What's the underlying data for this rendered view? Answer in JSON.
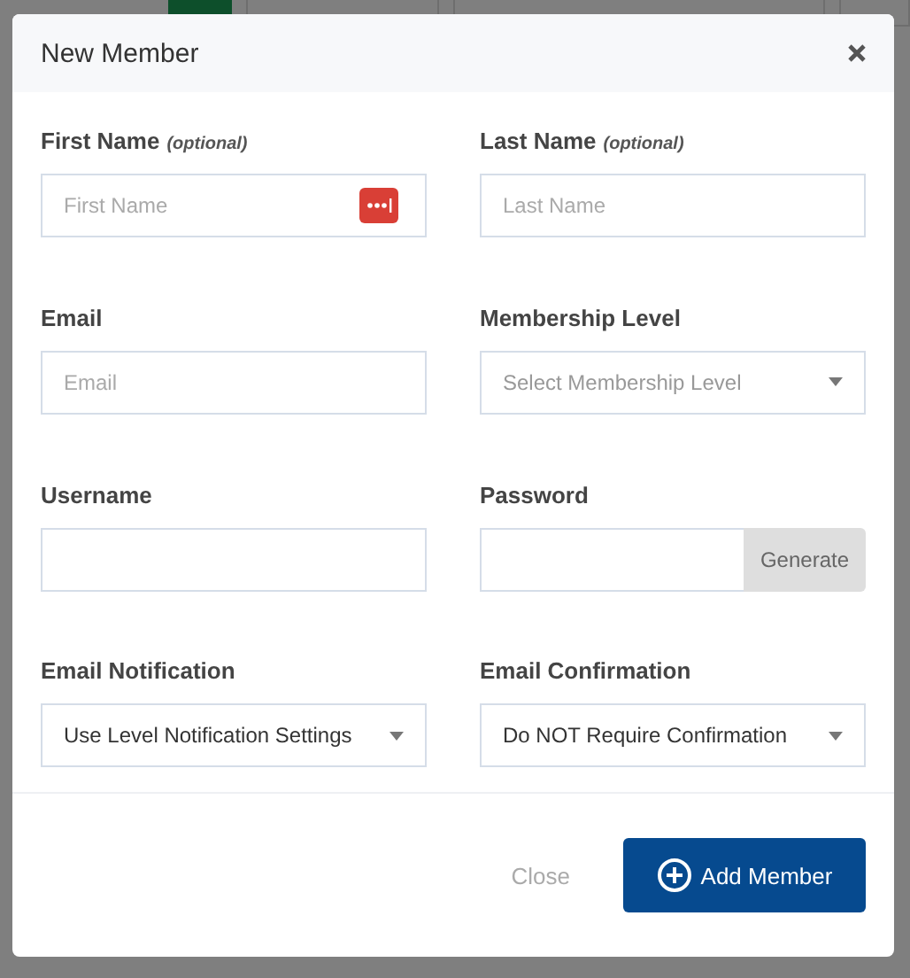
{
  "dialog": {
    "title": "New Member",
    "fields": [
      {
        "kind": "text",
        "label": "First Name",
        "note": "(optional)",
        "placeholder": "First Name",
        "autofill_badge": true
      },
      {
        "kind": "text",
        "label": "Last Name",
        "note": "(optional)",
        "placeholder": "Last Name",
        "autofill_badge": false
      },
      {
        "kind": "text",
        "label": "Email",
        "placeholder": "Email",
        "autofill_badge": false
      },
      {
        "kind": "select",
        "label": "Membership Level",
        "placeholder": "Select Membership Level"
      },
      {
        "kind": "text",
        "label": "Username",
        "autofill_badge": false
      },
      {
        "kind": "password",
        "label": "Password",
        "button": "Generate"
      },
      {
        "kind": "select",
        "label": "Email Notification",
        "value": "Use Level Notification Settings"
      },
      {
        "kind": "select",
        "label": "Email Confirmation",
        "value": "Do NOT Require Confirmation"
      }
    ],
    "buttons": [
      {
        "kind": "link",
        "label": "Close"
      },
      {
        "kind": "primary",
        "label": "Add Member"
      }
    ]
  }
}
